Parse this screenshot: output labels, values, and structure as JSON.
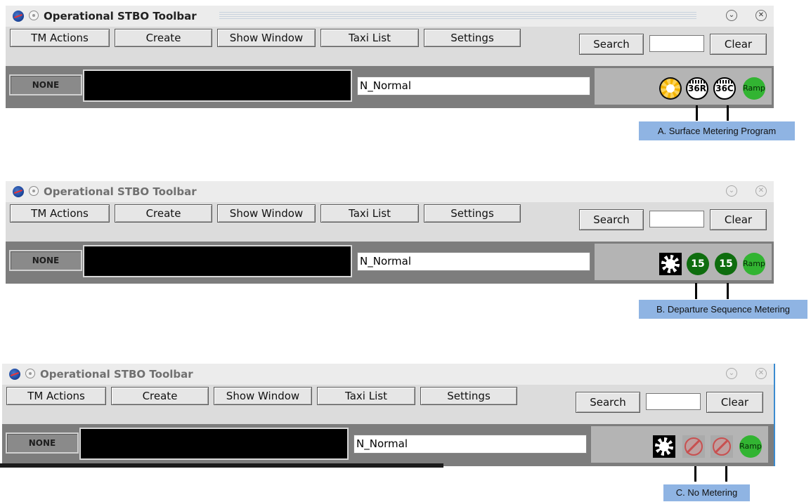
{
  "panels": [
    {
      "title": "Operational STBO Toolbar",
      "dimmed": false,
      "toolbar": {
        "tm_actions": "TM Actions",
        "create": "Create",
        "show_window": "Show Window",
        "taxi_list": "Taxi List",
        "settings": "Settings",
        "search": "Search",
        "clear": "Clear",
        "search_value": ""
      },
      "status": {
        "none": "NONE",
        "mode": "N_Normal"
      },
      "indicators": [
        {
          "kind": "gear-yellow",
          "icon": "yellow-gear-icon",
          "label": ""
        },
        {
          "kind": "rwy-white",
          "icon": "runway-36R-icon",
          "label": "36R"
        },
        {
          "kind": "rwy-white",
          "icon": "runway-36C-icon",
          "label": "36C"
        },
        {
          "kind": "ramp",
          "icon": "ramp-icon",
          "label": "Ramp"
        }
      ],
      "callout": "A. Surface Metering Program"
    },
    {
      "title": "Operational STBO Toolbar",
      "dimmed": true,
      "toolbar": {
        "tm_actions": "TM Actions",
        "create": "Create",
        "show_window": "Show Window",
        "taxi_list": "Taxi List",
        "settings": "Settings",
        "search": "Search",
        "clear": "Clear",
        "search_value": ""
      },
      "status": {
        "none": "NONE",
        "mode": "N_Normal"
      },
      "indicators": [
        {
          "kind": "gear-white",
          "icon": "white-gear-icon",
          "label": ""
        },
        {
          "kind": "rwy-green",
          "icon": "runway-15-icon",
          "label": "15"
        },
        {
          "kind": "rwy-green",
          "icon": "runway-15-icon",
          "label": "15"
        },
        {
          "kind": "ramp",
          "icon": "ramp-icon",
          "label": "Ramp"
        }
      ],
      "callout": "B. Departure Sequence Metering"
    },
    {
      "title": "Operational STBO Toolbar",
      "dimmed": true,
      "toolbar": {
        "tm_actions": "TM Actions",
        "create": "Create",
        "show_window": "Show Window",
        "taxi_list": "Taxi List",
        "settings": "Settings",
        "search": "Search",
        "clear": "Clear",
        "search_value": ""
      },
      "status": {
        "none": "NONE",
        "mode": "N_Normal"
      },
      "indicators": [
        {
          "kind": "gear-white",
          "icon": "white-gear-icon",
          "label": ""
        },
        {
          "kind": "no-meter",
          "icon": "no-metering-icon",
          "label": ""
        },
        {
          "kind": "no-meter",
          "icon": "no-metering-icon",
          "label": ""
        },
        {
          "kind": "ramp",
          "icon": "ramp-icon",
          "label": "Ramp"
        }
      ],
      "callout": "C. No Metering"
    }
  ],
  "colors": {
    "callout_bg": "#8fb4e3",
    "ramp_green": "#32b432",
    "runway_green": "#0e6d0e",
    "gear_yellow": "#f4b400"
  }
}
